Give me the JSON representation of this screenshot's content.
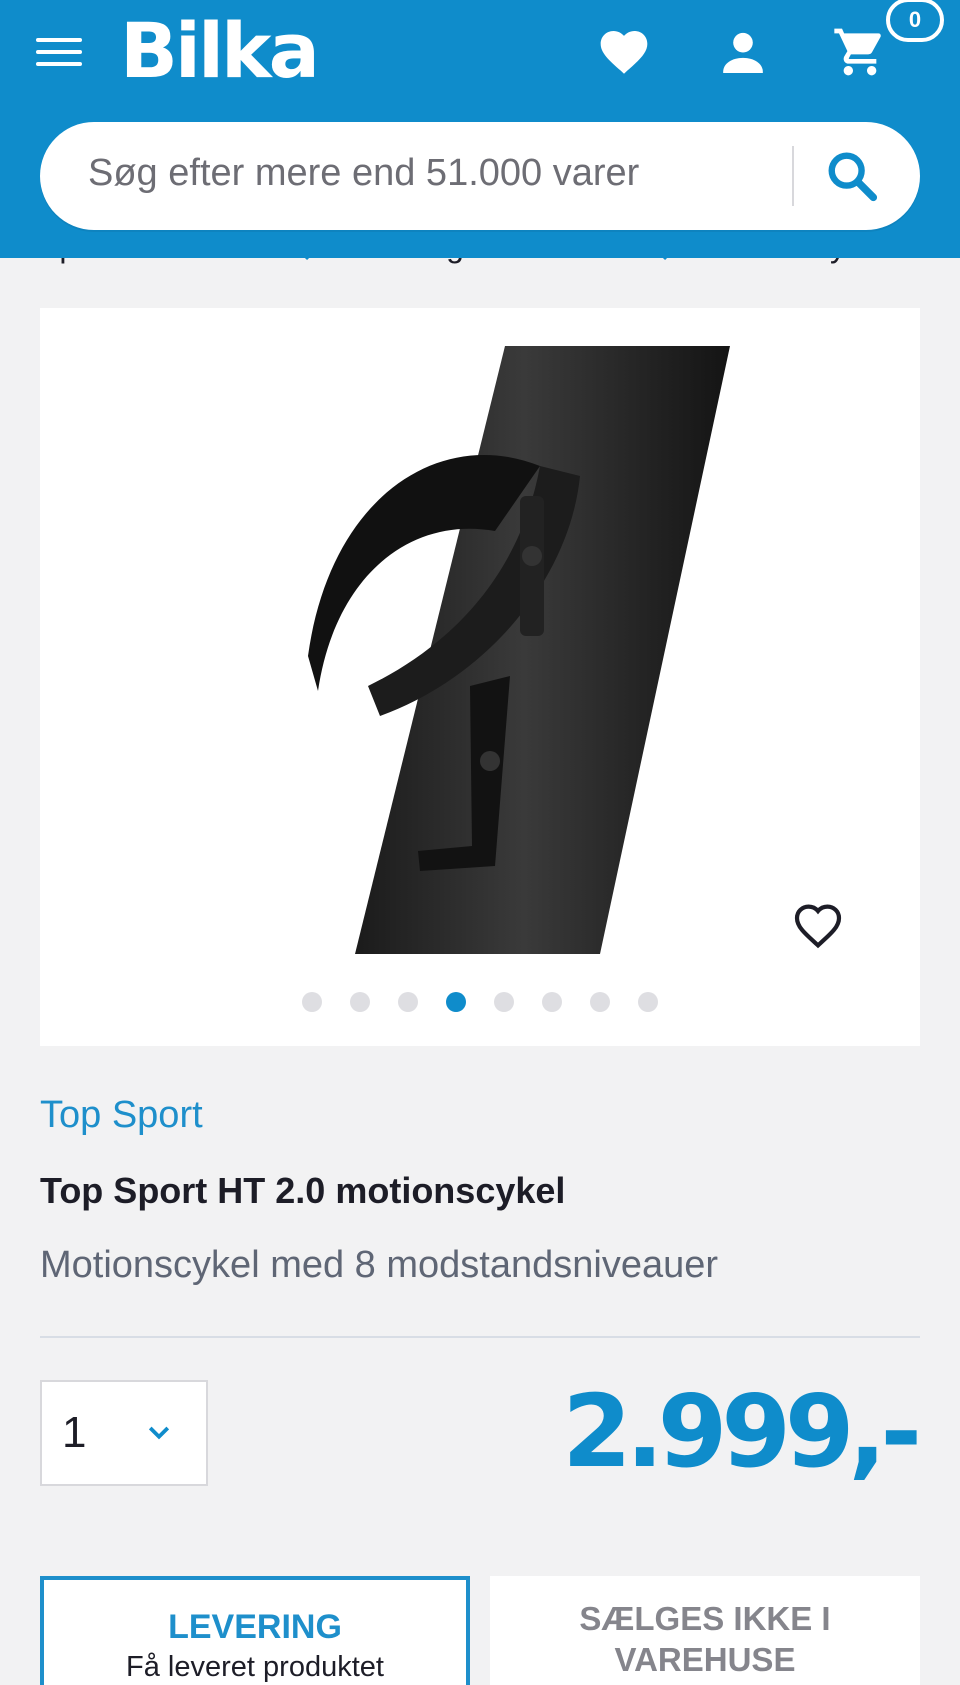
{
  "header": {
    "logo": "Bilka",
    "cart_count": "0"
  },
  "search": {
    "placeholder": "Søg efter mere end 51.000 varer"
  },
  "breadcrumb": [
    "Sport & motion",
    "Træningsmaskiner",
    "Motionscykler"
  ],
  "gallery": {
    "image_count": 8,
    "active_index": 3
  },
  "product": {
    "brand": "Top Sport",
    "title": "Top Sport HT 2.0 motionscykel",
    "subtitle": "Motionscykel med 8 modstandsniveauer",
    "price": "2.999,-",
    "quantity": "1"
  },
  "delivery": {
    "title": "LEVERING",
    "text": "Få leveret produktet"
  },
  "store": {
    "text": "SÆLGES IKKE I VAREHUSE"
  },
  "icons": [
    "menu-icon",
    "heart-icon",
    "user-icon",
    "cart-icon",
    "search-icon",
    "chevron-right-icon",
    "chevron-down-icon"
  ],
  "colors": {
    "brand_blue": "#0f8ccb",
    "background": "#f2f2f3",
    "text_dark": "#1d1d27",
    "text_muted": "#5f6675"
  }
}
